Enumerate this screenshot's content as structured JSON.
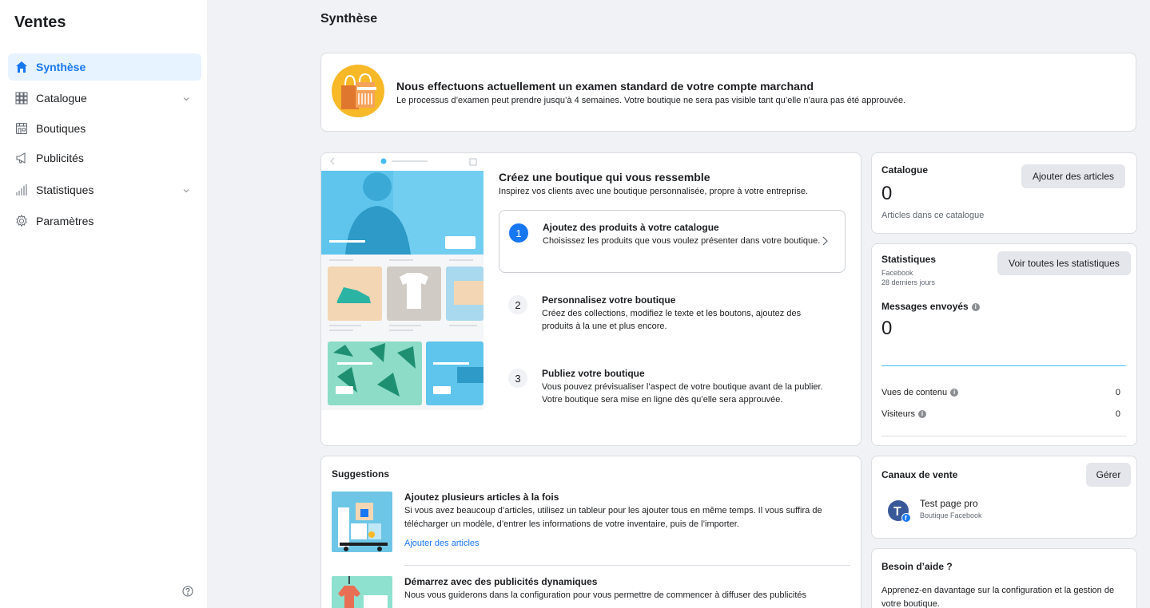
{
  "sidebar": {
    "title": "Ventes",
    "items": [
      {
        "label": "Synthèse",
        "icon": "home-icon"
      },
      {
        "label": "Catalogue",
        "icon": "grid-icon"
      },
      {
        "label": "Boutiques",
        "icon": "storefront-icon"
      },
      {
        "label": "Publicités",
        "icon": "megaphone-icon"
      },
      {
        "label": "Statistiques",
        "icon": "bar-chart-icon"
      },
      {
        "label": "Paramètres",
        "icon": "gear-icon"
      }
    ]
  },
  "page": {
    "title": "Synthèse"
  },
  "banner": {
    "title": "Nous effectuons actuellement un examen standard de votre compte marchand",
    "text": "Le processus d’examen peut prendre jusqu’à 4 semaines. Votre boutique ne sera pas visible tant qu’elle n’aura pas été approuvée."
  },
  "setup": {
    "title": "Créez une boutique qui vous ressemble",
    "subtitle": "Inspirez vos clients avec une boutique personnalisée, propre à votre entreprise.",
    "steps": [
      {
        "number": "1",
        "title": "Ajoutez des produits à votre catalogue",
        "text": "Choisissez les produits que vous voulez présenter dans votre boutique."
      },
      {
        "number": "2",
        "title": "Personnalisez votre boutique",
        "text": "Créez des collections, modifiez le texte et les boutons, ajoutez des produits à la une et plus encore."
      },
      {
        "number": "3",
        "title": "Publiez votre boutique",
        "text": "Vous pouvez prévisualiser l’aspect de votre boutique avant de la publier. Votre boutique sera mise en ligne dès qu’elle sera approuvée."
      }
    ]
  },
  "catalogue": {
    "title": "Catalogue",
    "count": "0",
    "caption": "Articles dans ce catalogue",
    "button": "Ajouter des articles"
  },
  "stats": {
    "title": "Statistiques",
    "source": "Facebook",
    "period": "28 derniers jours",
    "button": "Voir toutes les statistiques",
    "metric_label": "Messages envoyés",
    "metric_value": "0",
    "rows": [
      {
        "label": "Vues de contenu",
        "value": "0"
      },
      {
        "label": "Visiteurs",
        "value": "0"
      }
    ]
  },
  "suggestions": {
    "title": "Suggestions",
    "items": [
      {
        "title": "Ajoutez plusieurs articles à la fois",
        "text": "Si vous avez beaucoup d’articles, utilisez un tableur pour les ajouter tous en même temps. Il vous suffira de télécharger un modèle, d’entrer les informations de votre inventaire, puis de l’importer.",
        "link": "Ajouter des articles"
      },
      {
        "title": "Démarrez avec des publicités dynamiques",
        "text": "Nous vous guiderons dans la configuration pour vous permettre de commencer à diffuser des publicités"
      }
    ]
  },
  "channels": {
    "title": "Canaux de vente",
    "button": "Gérer",
    "page_name": "Test page pro",
    "page_sub": "Boutique Facebook"
  },
  "help": {
    "title": "Besoin d’aide ?",
    "text": "Apprenez-en davantage sur la configuration et la gestion de votre boutique."
  },
  "colors": {
    "accent": "#1877f2",
    "active_bg": "#e7f3ff",
    "page_bg": "#f0f2f5"
  }
}
